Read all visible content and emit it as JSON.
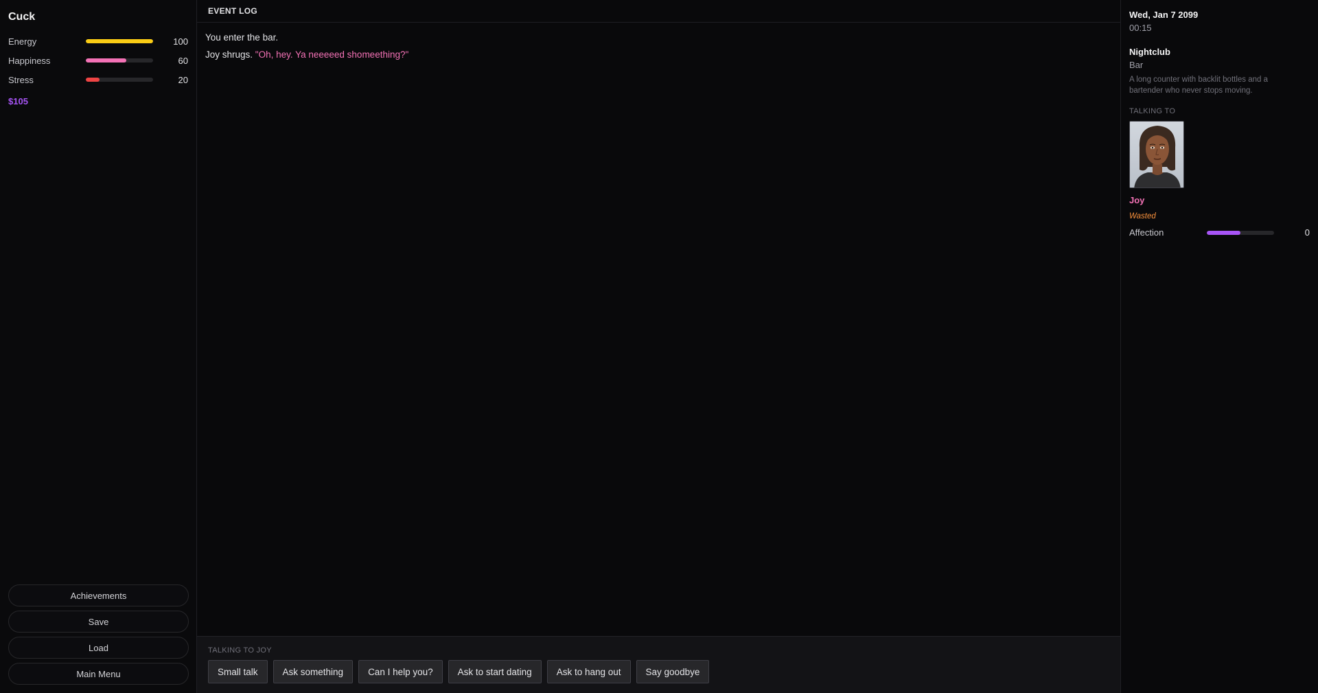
{
  "player": {
    "name": "Cuck",
    "money": "$105",
    "stats": [
      {
        "label": "Energy",
        "value": "100",
        "level": 1.0,
        "color": "#facc15"
      },
      {
        "label": "Happiness",
        "value": "60",
        "level": 0.6,
        "color": "#f472b6"
      },
      {
        "label": "Stress",
        "value": "20",
        "level": 0.2,
        "color": "#ef4444"
      }
    ]
  },
  "menu": {
    "achievements": "Achievements",
    "save": "Save",
    "load": "Load",
    "main_menu": "Main Menu"
  },
  "log": {
    "title": "EVENT LOG",
    "line1": "You enter the bar.",
    "line2_prefix": "Joy shrugs. ",
    "line2_quote": "\"Oh, hey. Ya neeeeed shomeething?\""
  },
  "talk": {
    "title": "TALKING TO JOY",
    "options": [
      "Small talk",
      "Ask something",
      "Can I help you?",
      "Ask to start dating",
      "Ask to hang out",
      "Say goodbye"
    ]
  },
  "info": {
    "date": "Wed, Jan 7 2099",
    "time": "00:15",
    "location": "Nightclub",
    "sublocation": "Bar",
    "description": "A long counter with backlit bottles and a bartender who never stops moving.",
    "talking_label": "TALKING TO"
  },
  "npc": {
    "name": "Joy",
    "status": "Wasted",
    "affection_label": "Affection",
    "affection_value": "0",
    "affection_level": 0.5
  },
  "colors": {
    "accent": "#a855f7",
    "npc_name": "#f472b6",
    "status": "#fb923c"
  }
}
